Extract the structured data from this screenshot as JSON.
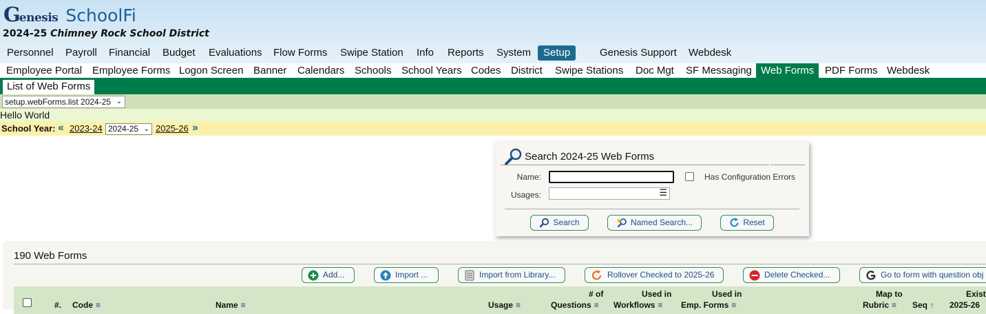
{
  "brand": {
    "logo_big": "G",
    "logo_small": "enesis",
    "app": "SchoolFi"
  },
  "district": {
    "year": "2024-25",
    "name": "Chimney Rock School District"
  },
  "main_nav": [
    "Personnel",
    "Payroll",
    "Financial",
    "Budget",
    "Evaluations",
    "Flow Forms",
    "Swipe Station",
    "Info",
    "Reports",
    "System",
    "Setup",
    "Genesis Support",
    "Webdesk"
  ],
  "sub_nav": [
    "Employee Portal",
    "Employee Forms",
    "Logon Screen",
    "Banner",
    "Calendars",
    "Schools",
    "School Years",
    "Codes",
    "District",
    "Swipe Stations",
    "Doc Mgt",
    "SF Messaging",
    "Web Forms",
    "PDF Forms",
    "Webdesk"
  ],
  "page_tab": "List of Web Forms",
  "page_select": "setup.webForms.list 2024-25",
  "hello": "Hello World",
  "school_year": {
    "label": "School Year:",
    "prev": "2023-24",
    "current": "2024-25",
    "next": "2025-26"
  },
  "search": {
    "title": "Search 2024-25 Web Forms",
    "name_label": "Name:",
    "name_value": "",
    "config_errors_label": "Has Configuration Errors",
    "usages_label": "Usages:",
    "search_btn": "Search",
    "named_search_btn": "Named Search...",
    "reset_btn": "Reset"
  },
  "list": {
    "title": "190 Web Forms",
    "buttons": {
      "add": "Add...",
      "import": "Import ...",
      "import_library": "Import from Library...",
      "rollover": "Rollover Checked to 2025-26",
      "delete": "Delete Checked...",
      "goto": "Go to form with question obj"
    },
    "columns": {
      "num": "#.",
      "code": "Code",
      "name": "Name",
      "usage": "Usage",
      "questions_top": "# of",
      "questions": "Questions",
      "workflows_top": "Used in",
      "workflows": "Workflows",
      "empforms_top": "Used in",
      "empforms": "Emp. Forms",
      "rubric_top": "Map to",
      "rubric": "Rubric",
      "seq": "Seq",
      "exists_top": "Exists",
      "exists": "2025-26"
    }
  }
}
